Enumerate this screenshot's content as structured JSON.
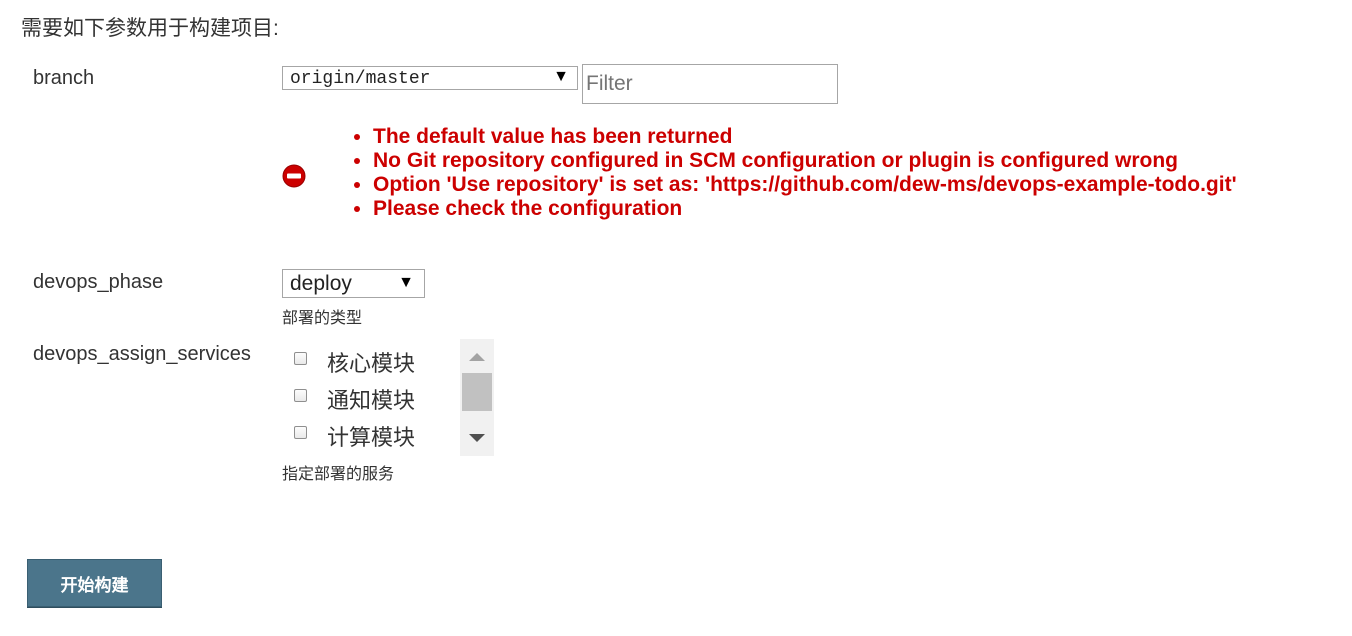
{
  "heading": "需要如下参数用于构建项目:",
  "parameters": {
    "branch": {
      "label": "branch",
      "selected": "origin/master",
      "filter_placeholder": "Filter",
      "errors": [
        "The default value has been returned",
        "No Git repository configured in SCM configuration or plugin is configured wrong",
        "Option 'Use repository' is set as: 'https://github.com/dew-ms/devops-example-todo.git'",
        "Please check the configuration"
      ]
    },
    "devops_phase": {
      "label": "devops_phase",
      "selected": "deploy",
      "description": "部署的类型"
    },
    "devops_assign_services": {
      "label": "devops_assign_services",
      "options": [
        "核心模块",
        "通知模块",
        "计算模块"
      ],
      "description": "指定部署的服务"
    }
  },
  "submit_label": "开始构建",
  "colors": {
    "error": "#cc0000",
    "button": "#4b758b"
  },
  "icons": {
    "error": "error-icon",
    "dropdown": "dropdown-arrow-icon"
  }
}
